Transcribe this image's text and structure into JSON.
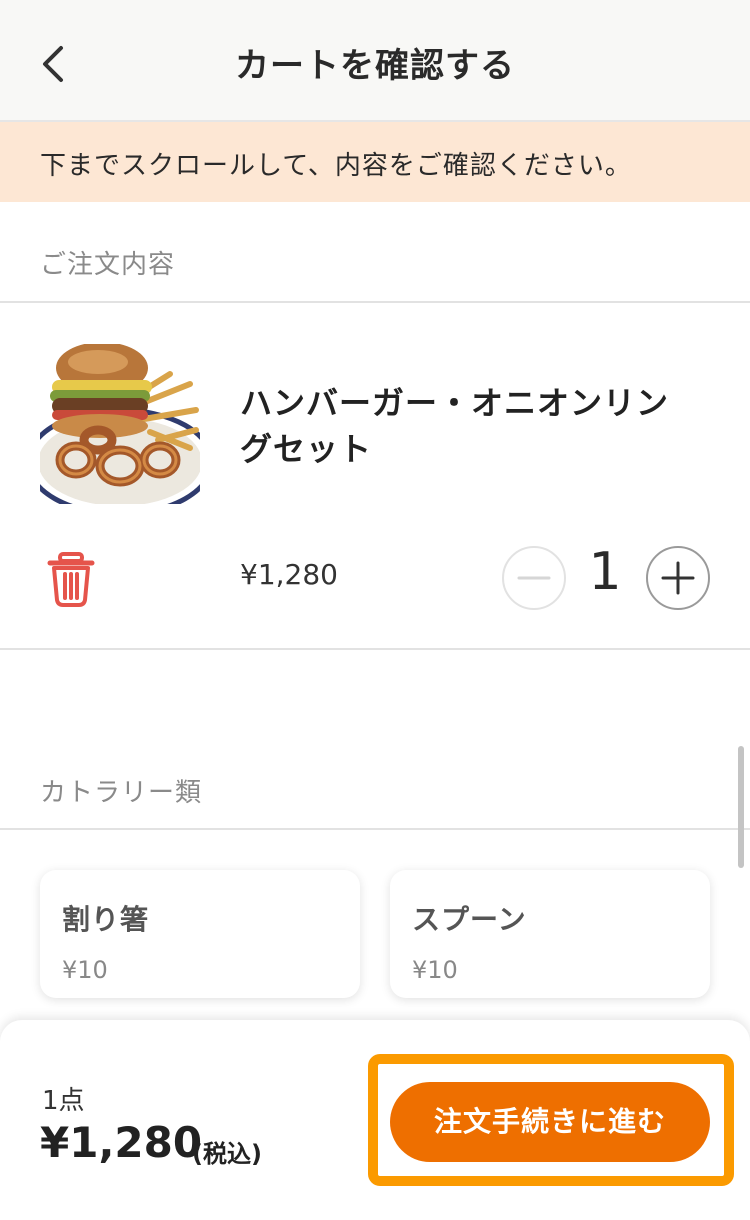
{
  "header": {
    "title": "カートを確認する",
    "back_icon": "chevron-left-icon"
  },
  "notice": {
    "text": "下までスクロールして、内容をご確認ください。"
  },
  "order_section": {
    "label": "ご注文内容"
  },
  "item": {
    "name": "ハンバーガー・オニオンリングセット",
    "price": "¥1,280",
    "quantity": "1",
    "delete_icon": "trash-icon",
    "minus_icon": "minus-icon",
    "plus_icon": "plus-icon"
  },
  "cutlery_section": {
    "label": "カトラリー類",
    "items": [
      {
        "name": "割り箸",
        "price": "¥10"
      },
      {
        "name": "スプーン",
        "price": "¥10"
      }
    ]
  },
  "footer": {
    "count": "1点",
    "total": "¥1,280",
    "tax_note": "(税込)",
    "cta_label": "注文手続きに進む"
  },
  "colors": {
    "accent": "#ee6f00",
    "highlight": "#fb9a00",
    "notice_bg": "#fde7d4",
    "danger": "#e5544b"
  }
}
